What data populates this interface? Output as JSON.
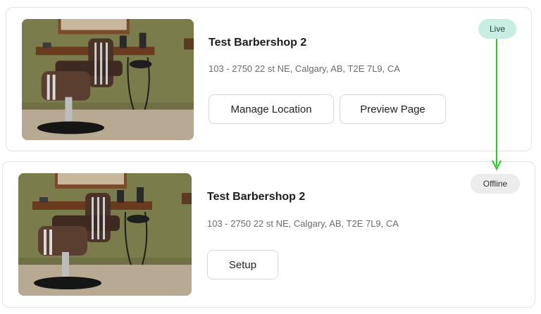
{
  "locations": [
    {
      "name": "Test Barbershop 2",
      "address": "103 - 2750 22 st NE, Calgary, AB, T2E 7L9, CA",
      "status": "Live",
      "buttons": {
        "manage": "Manage Location",
        "preview": "Preview Page"
      }
    },
    {
      "name": "Test Barbershop 2",
      "address": "103 - 2750 22 st NE, Calgary, AB, T2E 7L9, CA",
      "status": "Offline",
      "buttons": {
        "setup": "Setup"
      }
    }
  ],
  "colors": {
    "live_badge_bg": "#c8ede3",
    "offline_badge_bg": "#ececec",
    "annotation_arrow": "#22cc22"
  }
}
